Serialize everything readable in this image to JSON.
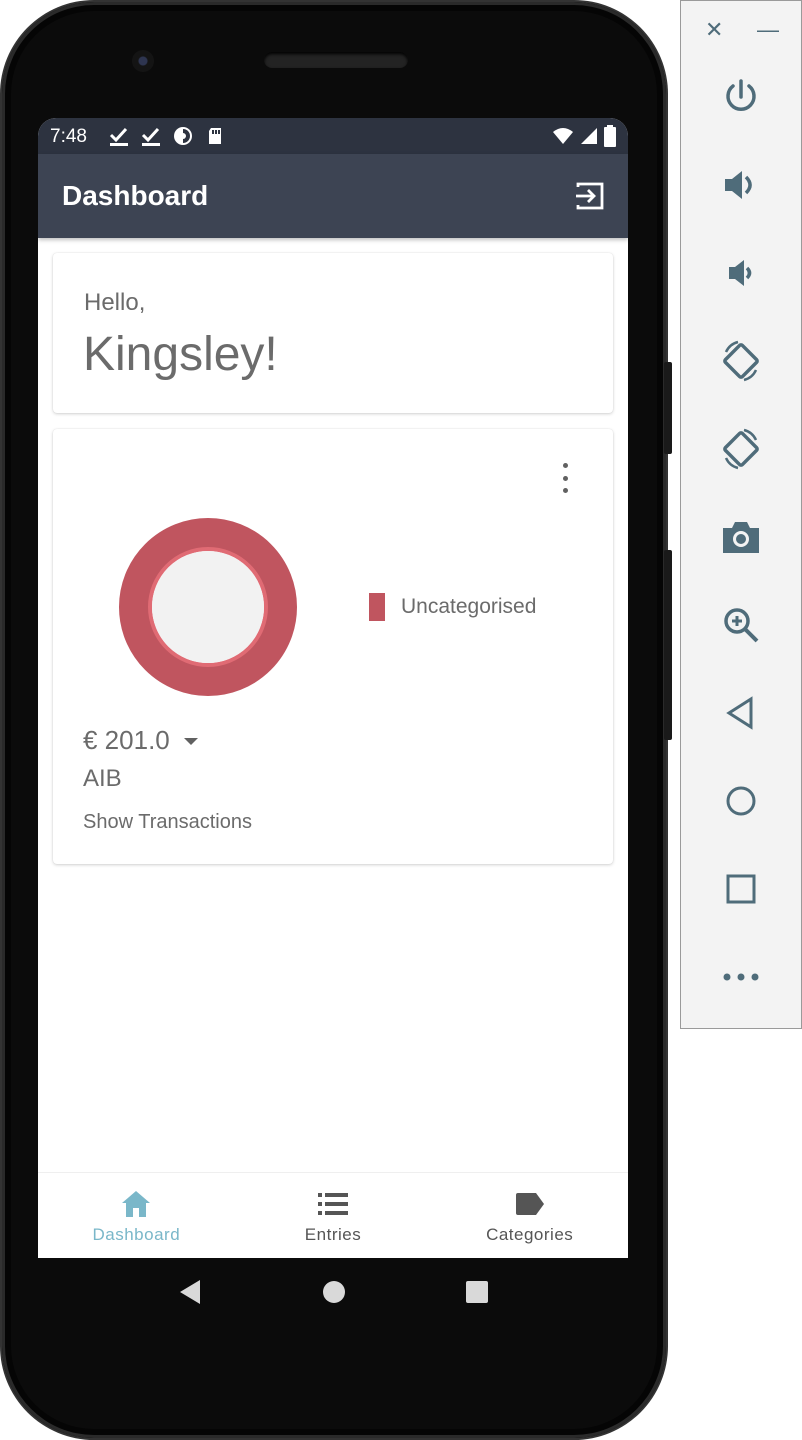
{
  "status_bar": {
    "time": "7:48"
  },
  "app_bar": {
    "title": "Dashboard"
  },
  "greeting": {
    "hello": "Hello,",
    "name": "Kingsley!"
  },
  "account": {
    "amount": "€ 201.0",
    "bank": "AIB",
    "show_transactions": "Show Transactions",
    "legend": [
      {
        "label": "Uncategorised",
        "color": "#c0555f"
      }
    ]
  },
  "chart_data": {
    "type": "pie",
    "categories": [
      "Uncategorised"
    ],
    "values": [
      201.0
    ],
    "colors": [
      "#c0555f"
    ]
  },
  "bottom_nav": {
    "items": [
      {
        "label": "Dashboard",
        "icon": "home-icon",
        "active": true
      },
      {
        "label": "Entries",
        "icon": "list-icon",
        "active": false
      },
      {
        "label": "Categories",
        "icon": "label-tag-icon",
        "active": false
      }
    ]
  },
  "colors": {
    "app_bar": "#3d4453",
    "status_bar": "#2d3340",
    "accent": "#7ab7c9",
    "donut": "#c0555f"
  },
  "emulator_toolbar": {
    "buttons": [
      "close-icon",
      "minimize-icon",
      "power-icon",
      "volume-up-icon",
      "volume-down-icon",
      "rotate-left-icon",
      "rotate-right-icon",
      "camera-icon",
      "zoom-icon",
      "back-icon",
      "home-icon",
      "overview-icon",
      "more-icon"
    ]
  }
}
